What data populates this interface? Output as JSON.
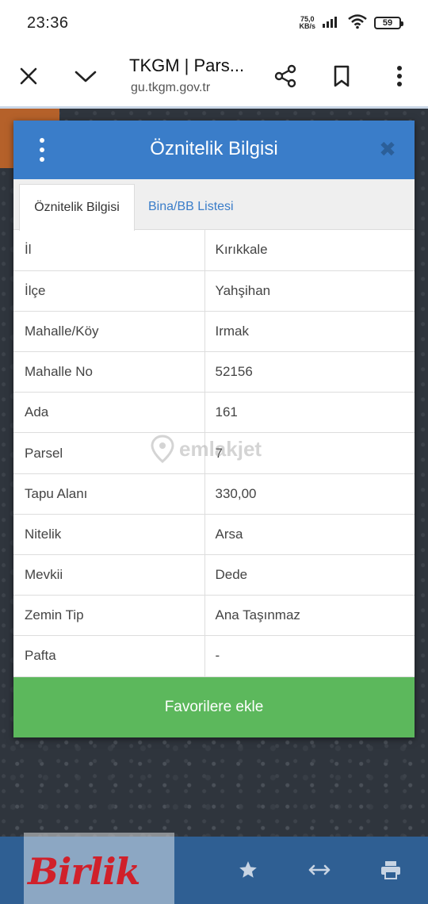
{
  "status_bar": {
    "time": "23:36",
    "net_speed_value": "75,0",
    "net_speed_unit": "KB/s",
    "battery": "59"
  },
  "browser": {
    "title": "TKGM | Pars...",
    "url": "gu.tkgm.gov.tr",
    "icons": [
      "close-icon",
      "chevron-down-icon",
      "share-icon",
      "bookmark-icon",
      "more-vert-icon"
    ]
  },
  "dialog": {
    "title": "Öznitelik Bilgisi",
    "close_symbol": "✖",
    "tabs": [
      {
        "label": "Öznitelik Bilgisi",
        "active": true
      },
      {
        "label": "Bina/BB Listesi",
        "active": false
      }
    ],
    "rows": [
      {
        "key": "İl",
        "value": "Kırıkkale"
      },
      {
        "key": "İlçe",
        "value": "Yahşihan"
      },
      {
        "key": "Mahalle/Köy",
        "value": "Irmak"
      },
      {
        "key": "Mahalle No",
        "value": "52156"
      },
      {
        "key": "Ada",
        "value": "161"
      },
      {
        "key": "Parsel",
        "value": "7"
      },
      {
        "key": "Tapu Alanı",
        "value": "330,00"
      },
      {
        "key": "Nitelik",
        "value": "Arsa"
      },
      {
        "key": "Mevkii",
        "value": "Dede"
      },
      {
        "key": "Zemin Tip",
        "value": "Ana Taşınmaz"
      },
      {
        "key": "Pafta",
        "value": "-"
      }
    ],
    "favorite_button": "Favorilere ekle"
  },
  "watermark": "emlakjet",
  "logo": "Birlik",
  "bottom_bar": {
    "icons": [
      "star-icon",
      "arrows-horizontal-icon",
      "print-icon"
    ]
  },
  "colors": {
    "header_blue": "#3a7dc9",
    "button_green": "#5cb85c",
    "bottom_bar_blue": "#2f5f93"
  }
}
